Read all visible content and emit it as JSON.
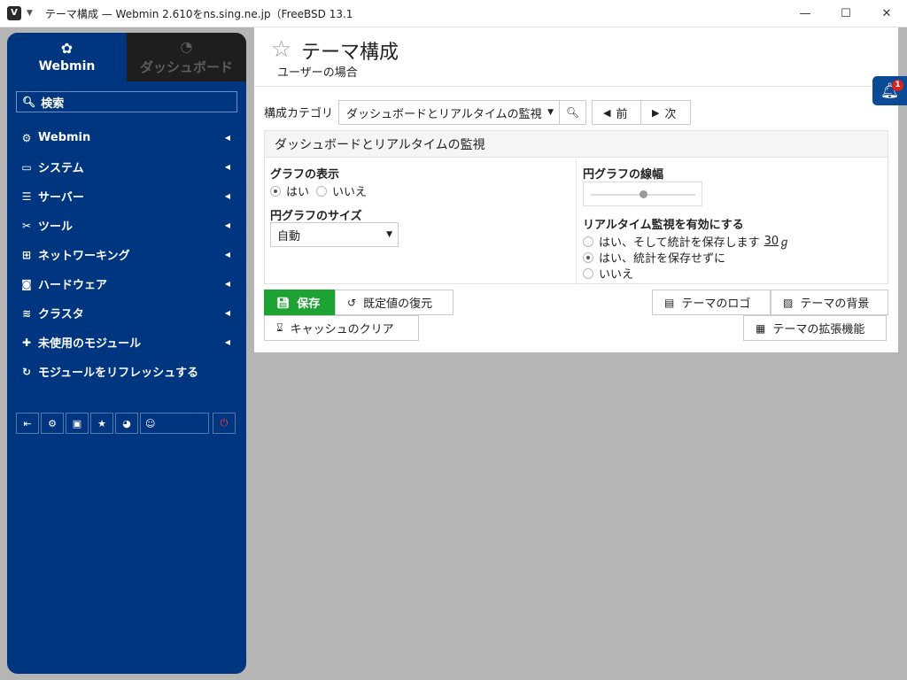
{
  "window": {
    "title": "テーマ構成 — Webmin 2.610をns.sing.ne.jp（FreeBSD 13.1",
    "minimize": "—",
    "maximize": "☐",
    "close": "✕"
  },
  "sidebar": {
    "tabs": [
      {
        "label": "Webmin",
        "icon": "webmin-logo-icon"
      },
      {
        "label": "ダッシュボード",
        "icon": "dashboard-gauge-icon"
      }
    ],
    "search_label": "検索",
    "items": [
      {
        "label": "Webmin",
        "icon": "gear-icon"
      },
      {
        "label": "システム",
        "icon": "laptop-icon"
      },
      {
        "label": "サーバー",
        "icon": "server-icon"
      },
      {
        "label": "ツール",
        "icon": "tools-icon"
      },
      {
        "label": "ネットワーキング",
        "icon": "network-icon"
      },
      {
        "label": "ハードウェア",
        "icon": "hdd-icon"
      },
      {
        "label": "クラスタ",
        "icon": "layers-icon"
      },
      {
        "label": "未使用のモジュール",
        "icon": "puzzle-icon"
      },
      {
        "label": "モジュールをリフレッシュする",
        "icon": "refresh-icon"
      }
    ]
  },
  "header": {
    "title": "テーマ構成",
    "subtitle": "ユーザーの場合"
  },
  "toolbar": {
    "category_label": "構成カテゴリ",
    "category_value": "ダッシュボードとリアルタイムの監視",
    "prev_label": "前",
    "next_label": "次"
  },
  "section": {
    "title": "ダッシュボードとリアルタイムの監視",
    "graph_display_label": "グラフの表示",
    "graph_display_options": [
      {
        "label": "はい",
        "selected": true
      },
      {
        "label": "いいえ",
        "selected": false
      }
    ],
    "pie_size_label": "円グラフのサイズ",
    "pie_size_value": "自動",
    "pie_width_label": "円グラフの線幅",
    "pie_width_level": 0.5,
    "realtime_label": "リアルタイム監視を有効にする",
    "realtime_options": [
      {
        "label": "はい、そして統計を保存します",
        "selected": false
      },
      {
        "label": "はい、統計を保存せずに",
        "selected": true
      },
      {
        "label": "いいえ",
        "selected": false
      }
    ],
    "realtime_days": "30",
    "realtime_days_unit": "ℊ"
  },
  "buttons": {
    "save": "保存",
    "restore_defaults": "既定値の復元",
    "clear_cache": "キャッシュのクリア",
    "theme_logo": "テーマのロゴ",
    "theme_background": "テーマの背景",
    "theme_extensions": "テーマの拡張機能"
  },
  "notifications": {
    "count": "1"
  },
  "colors": {
    "sidebar_bg": "#003580",
    "save_green": "#1ea234",
    "badge_red": "#d9231e"
  }
}
